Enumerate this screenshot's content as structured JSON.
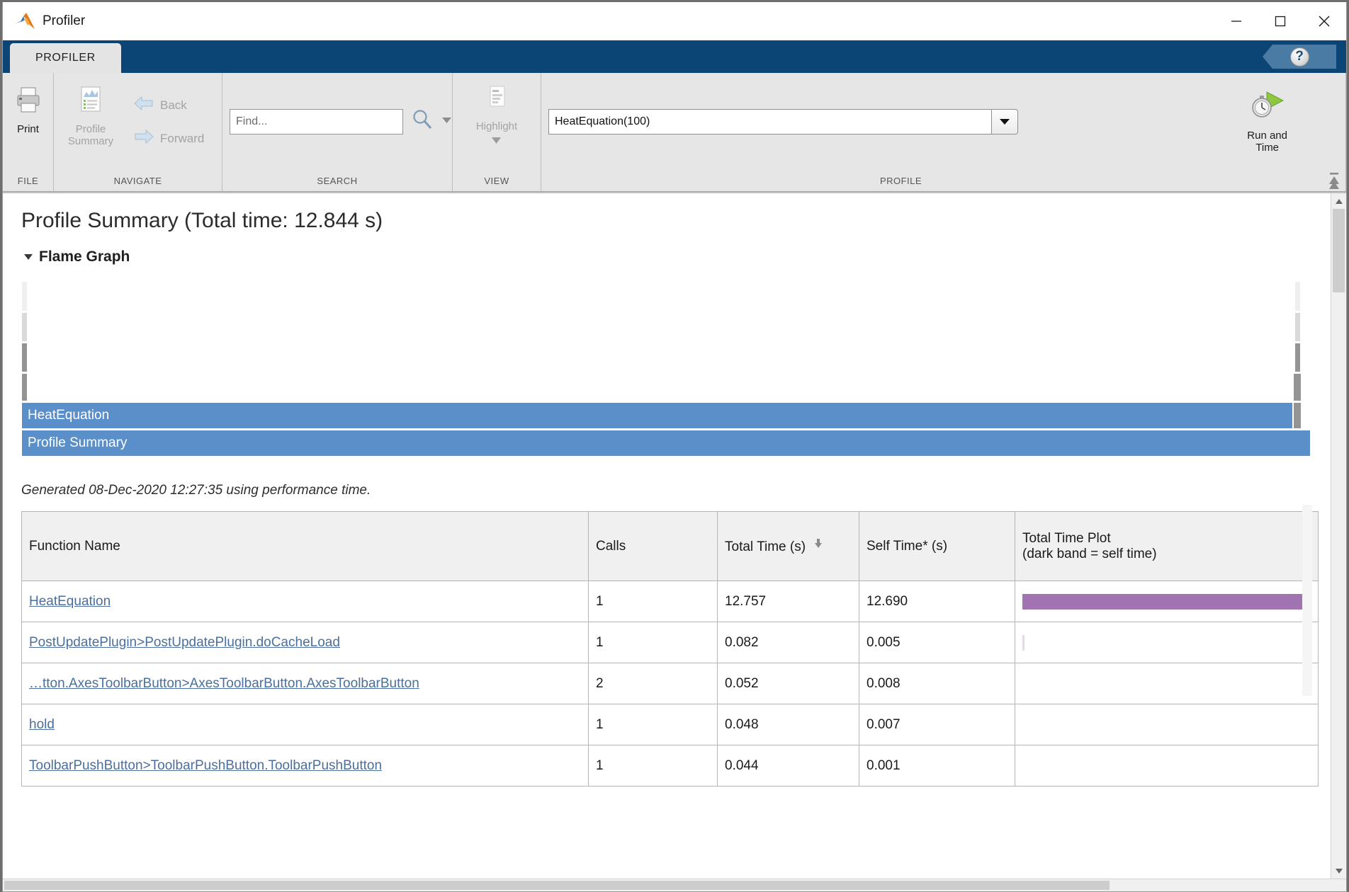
{
  "window": {
    "title": "Profiler",
    "app_icon": "matlab-logo-icon",
    "minimize_label": "─",
    "maximize_label": "□",
    "close_label": "✕"
  },
  "tabs": [
    {
      "label": "PROFILER",
      "active": true
    }
  ],
  "help": {
    "label": "?"
  },
  "ribbon": {
    "groups": [
      {
        "name": "FILE",
        "label": "FILE",
        "items": [
          {
            "label": "Print",
            "icon": "printer-icon",
            "disabled": false
          }
        ]
      },
      {
        "name": "NAVIGATE",
        "label": "NAVIGATE",
        "items": [
          {
            "label": "Profile\nSummary",
            "icon": "report-icon",
            "disabled": true
          },
          {
            "label": "Back",
            "icon": "arrow-left-icon",
            "disabled": true
          },
          {
            "label": "Forward",
            "icon": "arrow-right-icon",
            "disabled": true
          }
        ]
      },
      {
        "name": "SEARCH",
        "label": "SEARCH",
        "find_placeholder": "Find...",
        "find_value": "",
        "search_icon": "magnifier-icon",
        "dropdown_icon": "chevron-down-icon"
      },
      {
        "name": "VIEW",
        "label": "VIEW",
        "items": [
          {
            "label": "Highlight",
            "icon": "highlight-doc-icon",
            "disabled": true
          }
        ]
      },
      {
        "name": "PROFILE",
        "label": "PROFILE",
        "command_value": "HeatEquation(100)",
        "command_placeholder": "",
        "run_label": "Run and\nTime",
        "run_icon": "stopwatch-play-icon"
      }
    ]
  },
  "main": {
    "page_title": "Profile Summary (Total time: 12.844 s)",
    "flame_section_label": "Flame Graph",
    "generated_note": "Generated 08-Dec-2020 12:27:35 using performance time.",
    "flame_bars": [
      {
        "label": "",
        "level": 0,
        "left_pct": 2.6,
        "width_pct": 0.35,
        "color": "palegrey"
      },
      {
        "label": "",
        "level": 1,
        "left_pct": 2.6,
        "width_pct": 0.35,
        "color": "palegrey"
      },
      {
        "label": "",
        "level": 2,
        "left_pct": 2.6,
        "width_pct": 0.35,
        "color": "lightgrey"
      },
      {
        "label": "",
        "level": 3,
        "left_pct": 2.6,
        "width_pct": 0.35,
        "color": "grey"
      },
      {
        "label": "HeatEquation",
        "level": 4,
        "left_pct": 0,
        "width_pct": 100,
        "color": "blue"
      },
      {
        "label": "Profile Summary",
        "level": 5,
        "left_pct": 0,
        "width_pct": 100,
        "color": "blue"
      }
    ],
    "table": {
      "columns": [
        {
          "key": "name",
          "label": "Function Name",
          "sorted": false
        },
        {
          "key": "calls",
          "label": "Calls",
          "sorted": false
        },
        {
          "key": "total",
          "label": "Total Time (s)",
          "sorted": true,
          "sort_dir": "desc"
        },
        {
          "key": "self",
          "label": "Self Time* (s)",
          "sorted": false
        },
        {
          "key": "plot",
          "label": "Total Time Plot\n(dark band = self time)",
          "sorted": false
        }
      ],
      "rows": [
        {
          "name": "HeatEquation",
          "calls": "1",
          "total": "12.757",
          "self": "12.690",
          "bar_pct": 99.5,
          "self_pct": 99.0
        },
        {
          "name": "PostUpdatePlugin>PostUpdatePlugin.doCacheLoad",
          "calls": "1",
          "total": "0.082",
          "self": "0.005",
          "bar_pct": 0.7,
          "self_pct": 0.05
        },
        {
          "name": "…tton.AxesToolbarButton>AxesToolbarButton.AxesToolbarButton",
          "calls": "2",
          "total": "0.052",
          "self": "0.008",
          "bar_pct": 0.0,
          "self_pct": 0.0
        },
        {
          "name": "hold",
          "calls": "1",
          "total": "0.048",
          "self": "0.007",
          "bar_pct": 0.0,
          "self_pct": 0.0
        },
        {
          "name": "ToolbarPushButton>ToolbarPushButton.ToolbarPushButton",
          "calls": "1",
          "total": "0.044",
          "self": "0.001",
          "bar_pct": 0.0,
          "self_pct": 0.0
        }
      ]
    }
  },
  "chart_data": {
    "type": "bar",
    "title": "Total Time Plot (dark band = self time)",
    "categories": [
      "HeatEquation",
      "PostUpdatePlugin>PostUpdatePlugin.doCacheLoad",
      "…tton.AxesToolbarButton>AxesToolbarButton.AxesToolbarButton",
      "hold",
      "ToolbarPushButton>ToolbarPushButton.ToolbarPushButton"
    ],
    "series": [
      {
        "name": "Total Time (s)",
        "values": [
          12.757,
          0.082,
          0.052,
          0.048,
          0.044
        ]
      },
      {
        "name": "Self Time (s)",
        "values": [
          12.69,
          0.005,
          0.008,
          0.007,
          0.001
        ]
      }
    ],
    "calls": [
      1,
      1,
      2,
      1,
      1
    ],
    "xlabel": "Function Name",
    "ylabel": "Time (s)",
    "ylim": [
      0,
      12.757
    ],
    "grid": false,
    "legend": "none",
    "total_time_s": 12.844,
    "generated": "08-Dec-2020 12:27:35",
    "timer_type": "performance time"
  },
  "colors": {
    "accent_blue": "#0b4575",
    "flame_bar": "#5b8fc9",
    "plot_bar": "#ab7cb8",
    "link": "#4a6f9e",
    "ribbon_bg": "#e6e6e6"
  }
}
